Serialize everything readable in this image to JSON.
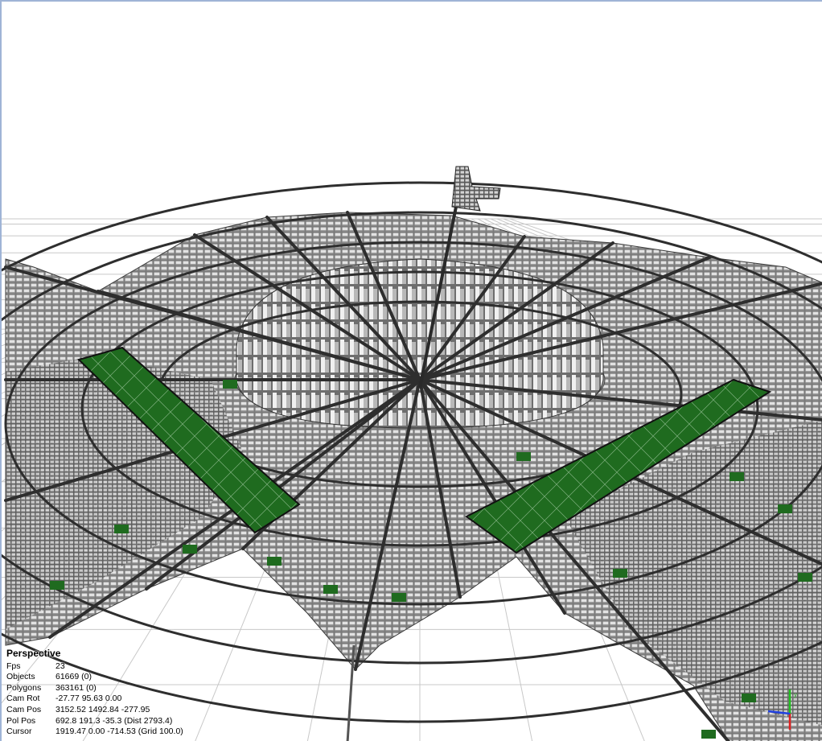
{
  "viewport": {
    "view_name": "Perspective",
    "stats": [
      {
        "label": "Fps",
        "value": "23"
      },
      {
        "label": "Objects",
        "value": "61669 (0)"
      },
      {
        "label": "Polygons",
        "value": "363161 (0)"
      },
      {
        "label": "Cam Rot",
        "value": "-27.77 95.63 0.00"
      },
      {
        "label": "Cam Pos",
        "value": "3152.52 1492.84 -277.95"
      },
      {
        "label": "Pol Pos",
        "value": "692.8 191.3 -35.3 (Dist 2793.4)"
      },
      {
        "label": "Cursor",
        "value": "1919.47 0.00 -714.53 (Grid 100.0)"
      }
    ]
  },
  "colors": {
    "park_green": "#1f6b1f",
    "road": "#2e2e2e",
    "building": "#c8c8c8",
    "grid_line": "#c8c8c8",
    "axis_x": "#e02020",
    "axis_y": "#20c020",
    "axis_z": "#2040e0"
  },
  "gizmo": {
    "icon": "axis-gizmo-icon"
  }
}
